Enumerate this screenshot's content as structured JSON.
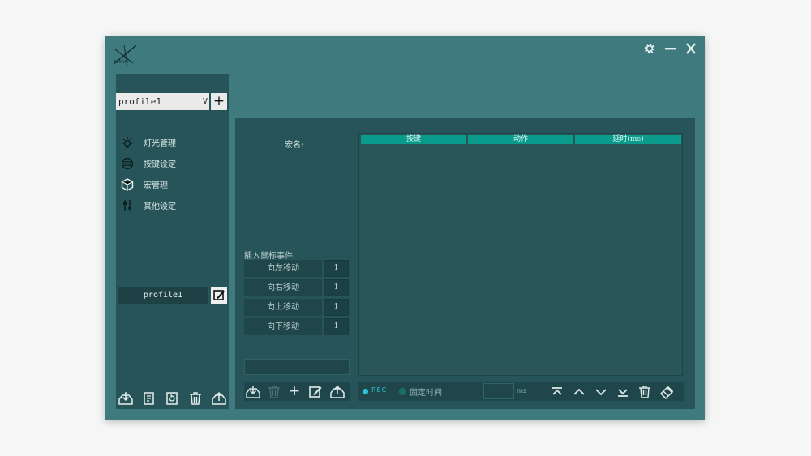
{
  "app": {
    "logo_text": "N·X·US"
  },
  "profile": {
    "selected": "profile1",
    "dropdown_arrow": "V",
    "add_label": "+",
    "current_name": "profile1"
  },
  "sidebar": {
    "items": [
      {
        "label": "灯光管理",
        "icon": "light-bulb-icon"
      },
      {
        "label": "按键设定",
        "icon": "keyboard-icon"
      },
      {
        "label": "宏管理",
        "icon": "cube-icon"
      },
      {
        "label": "其他设定",
        "icon": "sliders-icon"
      }
    ],
    "footer_icons": [
      "import-icon",
      "copy-icon",
      "refresh-icon",
      "trash-icon",
      "export-icon"
    ]
  },
  "macro": {
    "name_label": "宏名:",
    "insert_label": "插入鼠标事件",
    "moves": [
      {
        "label": "向左移动",
        "value": "1"
      },
      {
        "label": "向右移动",
        "value": "1"
      },
      {
        "label": "向上移动",
        "value": "1"
      },
      {
        "label": "向下移动",
        "value": "1"
      }
    ],
    "add_label": "+",
    "columns": [
      "按键",
      "动作",
      "延时(ms)"
    ],
    "rec_label": "REC",
    "fixed_time_label": "固定时间",
    "ms_unit": "ms"
  },
  "colors": {
    "window": "#3e7a7e",
    "panel": "#265458",
    "header": "#0b9b8c",
    "rec": "#2ec4d6"
  }
}
